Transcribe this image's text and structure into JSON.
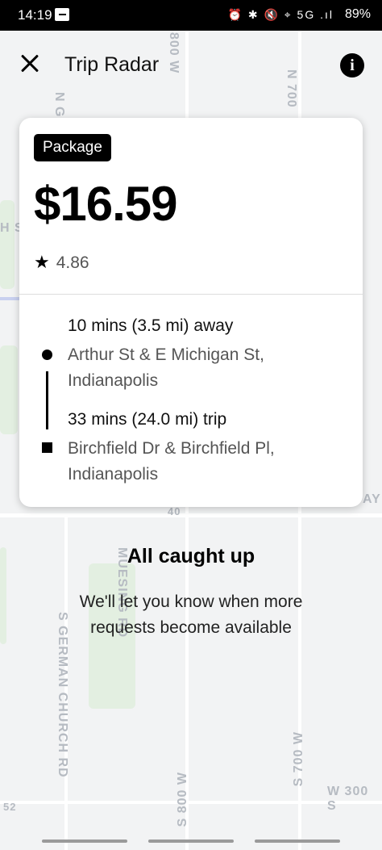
{
  "status_bar": {
    "time": "14:19",
    "icons": "⏰ ✱ 🔇 ⌖ 5G .ıl",
    "battery": "89%"
  },
  "header": {
    "title": "Trip Radar",
    "close_icon": "close-icon",
    "info_icon": "info-icon",
    "info_glyph": "i"
  },
  "map_labels": {
    "l1": "800 W",
    "l2": "N 700",
    "l3": "N G",
    "l4": "H S",
    "l5": "AY",
    "l6": "40",
    "l7": "MUESING RD",
    "l8": "S GERMAN CHURCH RD",
    "l9": "S 700 W",
    "l10": "S 800 W",
    "l11": "W 300 S",
    "l12": "52"
  },
  "request_card": {
    "badge": "Package",
    "fare": "$16.59",
    "rating": "4.86",
    "pickup_eta": "10 mins (3.5 mi) away",
    "pickup_address": "Arthur St & E Michigan St, Indianapolis",
    "trip_eta": "33 mins (24.0 mi) trip",
    "dropoff_address": "Birchfield Dr & Birchfield Pl, Indianapolis"
  },
  "empty_state": {
    "title": "All caught up",
    "subtitle": "We'll let you know when more requests become available"
  },
  "colors": {
    "map_bg": "#f2f3f4",
    "card_bg": "#ffffff",
    "badge_bg": "#000000",
    "text_primary": "#000000",
    "text_secondary": "#555555"
  }
}
